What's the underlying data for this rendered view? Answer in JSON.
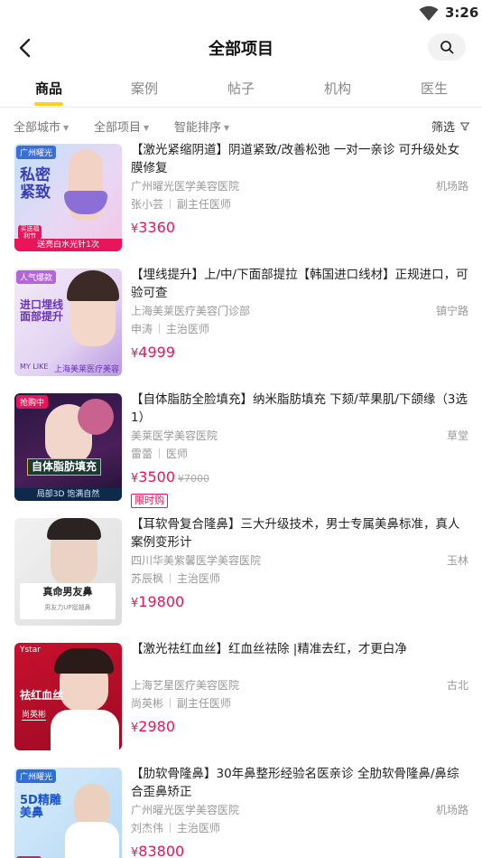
{
  "status": {
    "time": "3:26"
  },
  "header": {
    "title": "全部项目"
  },
  "tabs": [
    {
      "label": "商品",
      "active": true
    },
    {
      "label": "案例",
      "active": false
    },
    {
      "label": "帖子",
      "active": false
    },
    {
      "label": "机构",
      "active": false
    },
    {
      "label": "医生",
      "active": false
    }
  ],
  "filters": {
    "city": "全部城市",
    "project": "全部项目",
    "sort": "智能排序",
    "filter": "筛选"
  },
  "items": [
    {
      "title": "【激光紧缩阴道】阴道紧致/改善松弛 一对一亲诊 可升级处女膜修复",
      "clinic": "广州曜光医学美容医院",
      "location": "机场路",
      "doctor": "张小芸",
      "doctor_title": "副主任医师",
      "currency": "¥",
      "price": "3360",
      "thumb": {
        "badge": "广州曜光",
        "headline": "私密紧致",
        "ribbon": "送亮白水光针1次",
        "corner": "买送福利节"
      }
    },
    {
      "title": "【埋线提升】上/中/下面部提拉【韩国进口线材】正规进口，可验可查",
      "clinic": "上海美莱医疗美容门诊部",
      "location": "镇宁路",
      "doctor": "申涛",
      "doctor_title": "主治医师",
      "currency": "¥",
      "price": "4999",
      "thumb": {
        "badge": "人气爆款",
        "headline": "进口埋线\n面部提升",
        "ribbon": "上海美莱医疗美容",
        "corner": "MY LIKE"
      }
    },
    {
      "title": "【自体脂肪全脸填充】纳米脂肪填充 下颏/苹果肌/下颌缘（3选1）",
      "clinic": "美莱医学美容医院",
      "location": "草堂",
      "doctor": "雷蕾",
      "doctor_title": "医师",
      "currency": "¥",
      "price": "3500",
      "original_price": "¥7000",
      "tag": "限时购",
      "thumb": {
        "badge": "抢购中",
        "headline": "自体脂肪填充",
        "ribbon": "局部3D 饱满自然"
      }
    },
    {
      "title": "【耳软骨复合隆鼻】三大升级技术，男士专属美鼻标准，真人案例变形计",
      "clinic": "四川华美紫馨医学美容医院",
      "location": "玉林",
      "doctor": "苏辰枫",
      "doctor_title": "主治医师",
      "currency": "¥",
      "price": "19800",
      "thumb": {
        "headline": "真命男友鼻",
        "ribbon": "男友力UP挺翘鼻"
      }
    },
    {
      "title": "【激光祛红血丝】红血丝祛除 |精准去红，才更白净",
      "clinic": "上海艺星医疗美容医院",
      "location": "古北",
      "doctor": "尚英彬",
      "doctor_title": "副主任医师",
      "currency": "¥",
      "price": "2980",
      "thumb": {
        "badge": "Ystar",
        "headline": "祛红血丝",
        "ribbon": "尚英彬"
      }
    },
    {
      "title": "【肋软骨隆鼻】30年鼻整形经验名医亲诊 全肋软骨隆鼻/鼻综合歪鼻矫正",
      "clinic": "广州曜光医学美容医院",
      "location": "机场路",
      "doctor": "刘杰伟",
      "doctor_title": "主治医师",
      "currency": "¥",
      "price": "83800",
      "thumb": {
        "badge": "广州曜光",
        "headline": "5D精雕\n美鼻",
        "ribbon": "年中"
      }
    }
  ],
  "colors": {
    "accent": "#ffcf24",
    "price": "#e8155b",
    "muted": "#999999"
  }
}
